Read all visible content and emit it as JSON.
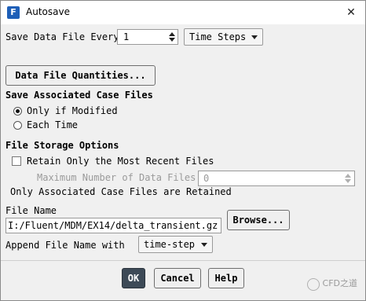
{
  "window": {
    "title": "Autosave",
    "app_icon_letter": "F"
  },
  "save_every": {
    "label": "Save Data File Every",
    "value": "1",
    "unit": "Time Steps"
  },
  "data_file_quantities_button": "Data File Quantities...",
  "case_files": {
    "heading": "Save Associated Case Files",
    "options": [
      "Only if Modified",
      "Each Time"
    ],
    "selected": "Only if Modified"
  },
  "storage": {
    "heading": "File Storage Options",
    "retain_label": "Retain Only the Most Recent Files",
    "retain_checked": false,
    "max_label": "Maximum Number of Data Files",
    "max_value": "0",
    "note": "Only Associated Case Files are Retained"
  },
  "file_name": {
    "label": "File Name",
    "value": "I:/Fluent/MDM/EX14/delta_transient.gz",
    "browse": "Browse..."
  },
  "append": {
    "label": "Append File Name with",
    "value": "time-step"
  },
  "buttons": {
    "ok": "OK",
    "cancel": "Cancel",
    "help": "Help"
  },
  "watermark": "CFD之道"
}
